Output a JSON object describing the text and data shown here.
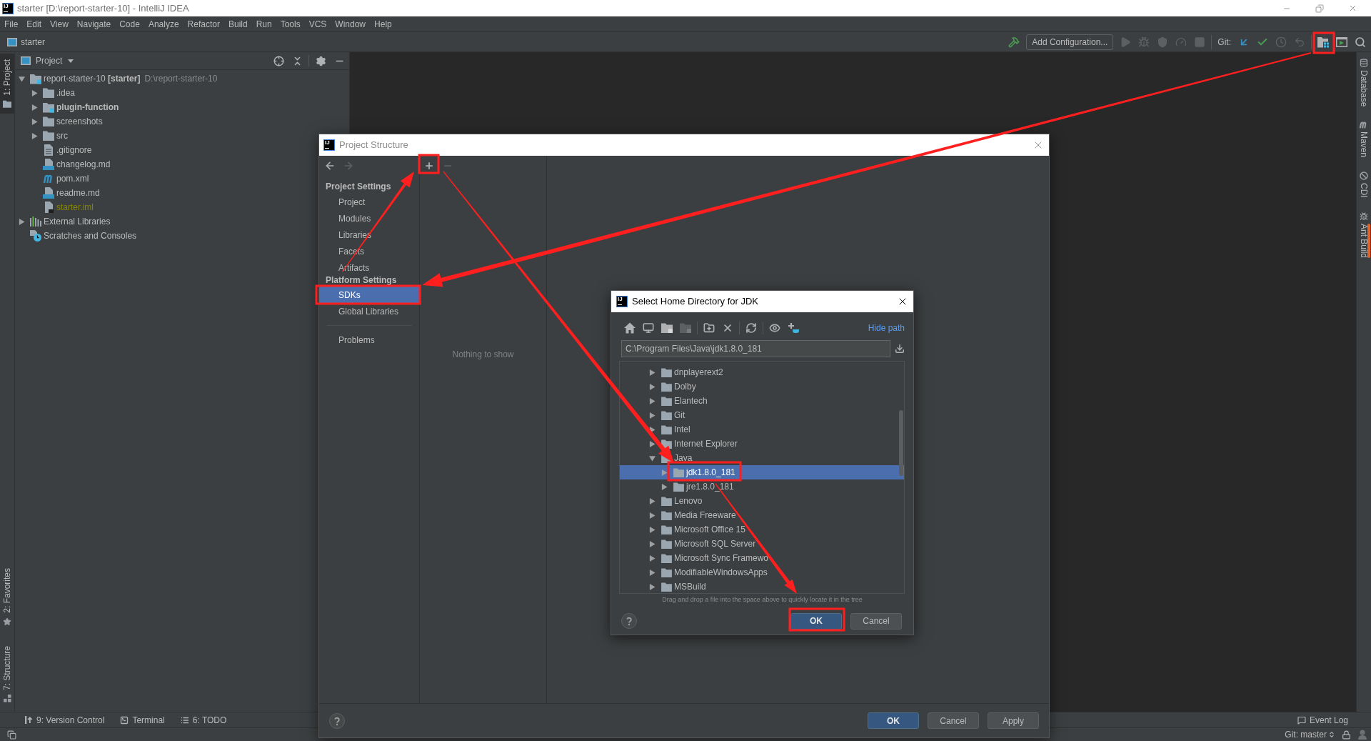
{
  "window": {
    "logo": "IJ",
    "title": "starter [D:\\report-starter-10] - IntelliJ IDEA",
    "active": false
  },
  "menu": [
    "File",
    "Edit",
    "View",
    "Navigate",
    "Code",
    "Analyze",
    "Refactor",
    "Build",
    "Run",
    "Tools",
    "VCS",
    "Window",
    "Help"
  ],
  "navigation_bar": {
    "breadcrumb": "starter",
    "toolbar": [
      {
        "kind": "build",
        "disabled": false
      },
      {
        "kind": "config",
        "label": "Add Configuration..."
      },
      {
        "kind": "run",
        "disabled": true
      },
      {
        "kind": "debug",
        "disabled": true
      },
      {
        "kind": "coverage",
        "disabled": true
      },
      {
        "kind": "profile",
        "disabled": true
      },
      {
        "kind": "stop",
        "disabled": true
      },
      {
        "kind": "separator"
      },
      {
        "kind": "label",
        "label": "Git:"
      },
      {
        "kind": "vcs-update",
        "disabled": false
      },
      {
        "kind": "vcs-commit",
        "disabled": false
      },
      {
        "kind": "history",
        "disabled": true
      },
      {
        "kind": "rollback",
        "disabled": true
      },
      {
        "kind": "separator"
      },
      {
        "kind": "project-structure",
        "disabled": false
      },
      {
        "kind": "run-window",
        "disabled": false
      },
      {
        "kind": "search",
        "disabled": false
      }
    ]
  },
  "left_tool_strip": {
    "top": [
      {
        "kind": "project",
        "label": "1: Project",
        "selected": true
      }
    ],
    "bottom": [
      {
        "kind": "favorites",
        "label": "2: Favorites",
        "selected": false
      },
      {
        "kind": "structure",
        "label": "7: Structure",
        "selected": false
      }
    ]
  },
  "project_panel": {
    "title": "Project",
    "tree": [
      {
        "kind": "project",
        "label": "report-starter-10 **[starter]**",
        "location": "D:\\report-starter-10",
        "expanded": true,
        "children": [
          {
            "kind": "folder",
            "label": ".idea",
            "expanded": false
          },
          {
            "kind": "module",
            "label": "plugin-function",
            "expanded": false
          },
          {
            "kind": "folder",
            "label": "screenshots",
            "expanded": false
          },
          {
            "kind": "folder",
            "label": "src",
            "expanded": false
          },
          {
            "kind": "text-file",
            "label": ".gitignore"
          },
          {
            "kind": "markdown",
            "label": "changelog.md"
          },
          {
            "kind": "maven",
            "label": "pom.xml"
          },
          {
            "kind": "markdown",
            "label": "readme.md"
          },
          {
            "kind": "module-file",
            "label": "starter.iml",
            "color": "#848504"
          }
        ]
      },
      {
        "kind": "libraries",
        "label": "External Libraries",
        "expanded": false
      },
      {
        "kind": "scratches",
        "label": "Scratches and Consoles"
      }
    ]
  },
  "right_tool_strip": [
    {
      "kind": "database",
      "label": "Database"
    },
    {
      "kind": "maven",
      "label": "Maven"
    },
    {
      "kind": "cdi",
      "label": "CDI"
    },
    {
      "kind": "ant",
      "label": "Ant Build"
    }
  ],
  "bottom_tool_strip": {
    "left": [
      {
        "kind": "version-control",
        "label": "9: Version Control"
      },
      {
        "kind": "terminal",
        "label": "Terminal"
      },
      {
        "kind": "todo",
        "label": "6: TODO"
      }
    ],
    "right": [
      {
        "kind": "event-log",
        "label": "Event Log"
      }
    ]
  },
  "status_bar": {
    "vcs_branch": "Git: master"
  },
  "project_structure_dialog": {
    "logo": "IJ",
    "title": "Project Structure",
    "active": false,
    "nav_buttons": [
      {
        "kind": "back",
        "disabled": false
      },
      {
        "kind": "forward",
        "disabled": true
      }
    ],
    "sections": [
      {
        "heading": "Project Settings",
        "items": [
          {
            "label": "Project",
            "selected": false
          },
          {
            "label": "Modules",
            "selected": false
          },
          {
            "label": "Libraries",
            "selected": false
          },
          {
            "label": "Facets",
            "selected": false
          },
          {
            "label": "Artifacts",
            "selected": false
          }
        ]
      },
      {
        "heading": "Platform Settings",
        "items": [
          {
            "label": "SDKs",
            "selected": true
          },
          {
            "label": "Global Libraries",
            "selected": false
          }
        ]
      },
      {
        "items": [
          {
            "label": "Problems",
            "selected": false
          }
        ]
      }
    ],
    "list_toolbar": [
      {
        "kind": "add",
        "disabled": false
      },
      {
        "kind": "remove",
        "disabled": true
      }
    ],
    "list_placeholder": "Nothing to show",
    "buttons": [
      {
        "kind": "ok",
        "label": "OK"
      },
      {
        "kind": "cancel",
        "label": "Cancel"
      },
      {
        "kind": "apply",
        "label": "Apply"
      }
    ]
  },
  "jdk_dialog": {
    "logo": "IJ",
    "title": "Select Home Directory for JDK",
    "active": true,
    "toolbar": [
      {
        "kind": "home",
        "disabled": false
      },
      {
        "kind": "desktop",
        "disabled": false
      },
      {
        "kind": "project-folder",
        "disabled": false
      },
      {
        "kind": "module-folder",
        "disabled": true
      },
      {
        "kind": "separator"
      },
      {
        "kind": "new-folder",
        "disabled": false
      },
      {
        "kind": "delete",
        "disabled": false
      },
      {
        "kind": "separator"
      },
      {
        "kind": "refresh",
        "disabled": false
      },
      {
        "kind": "separator"
      },
      {
        "kind": "show-hidden",
        "disabled": false
      },
      {
        "kind": "add-jdk",
        "disabled": false
      }
    ],
    "hide_path_link": "Hide path",
    "path": "C:\\Program Files\\Java\\jdk1.8.0_181",
    "tree": [
      {
        "label": "dnplayerext2",
        "expanded": false,
        "selected": false
      },
      {
        "label": "Dolby",
        "expanded": false,
        "selected": false
      },
      {
        "label": "Elantech",
        "expanded": false,
        "selected": false
      },
      {
        "label": "Git",
        "expanded": false,
        "selected": false
      },
      {
        "label": "Intel",
        "expanded": false,
        "selected": false
      },
      {
        "label": "Internet Explorer",
        "expanded": false,
        "selected": false
      },
      {
        "label": "Java",
        "expanded": true,
        "selected": false,
        "children": [
          {
            "label": "jdk1.8.0_181",
            "expanded": false,
            "selected": true
          },
          {
            "label": "jre1.8.0_181",
            "expanded": false,
            "selected": false
          }
        ]
      },
      {
        "label": "Lenovo",
        "expanded": false,
        "selected": false
      },
      {
        "label": "Media Freeware",
        "expanded": false,
        "selected": false
      },
      {
        "label": "Microsoft Office 15",
        "expanded": false,
        "selected": false
      },
      {
        "label": "Microsoft SQL Server",
        "expanded": false,
        "selected": false
      },
      {
        "label": "Microsoft Sync Framewo",
        "expanded": false,
        "selected": false
      },
      {
        "label": "ModifiableWindowsApps",
        "expanded": false,
        "selected": false
      },
      {
        "label": "MSBuild",
        "expanded": false,
        "selected": false
      }
    ],
    "hint": "Drag and drop a file into the space above to quickly locate it in the tree",
    "buttons": [
      {
        "kind": "ok",
        "label": "OK"
      },
      {
        "kind": "cancel",
        "label": "Cancel"
      }
    ]
  }
}
